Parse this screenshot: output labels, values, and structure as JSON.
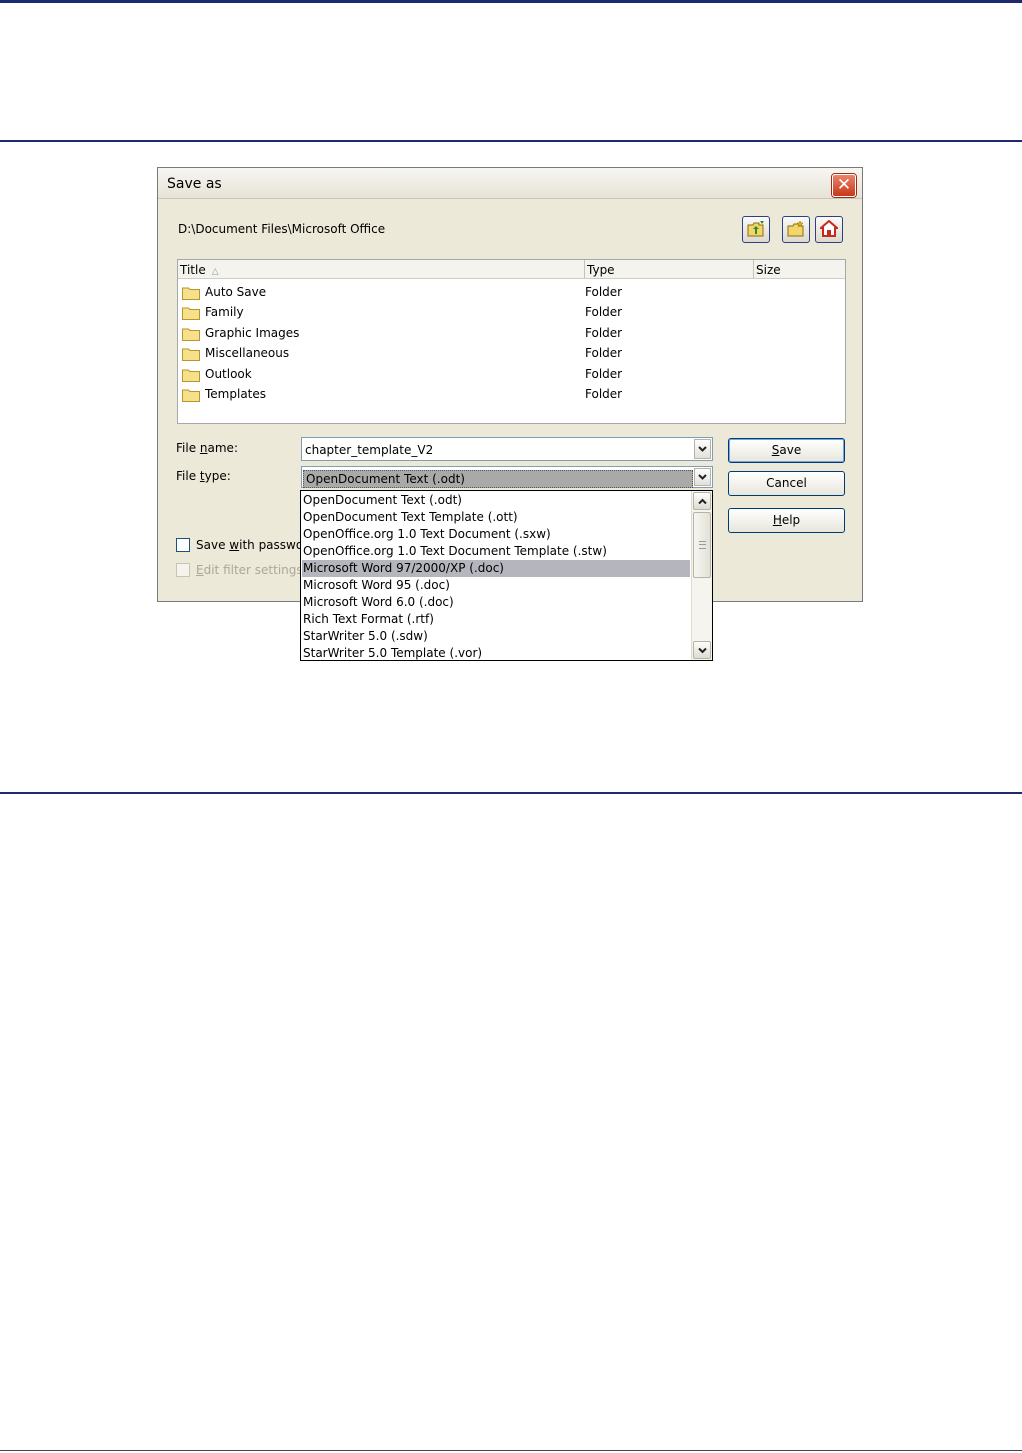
{
  "dialog": {
    "title": "Save as",
    "close_symbol": "✕",
    "path": "D:\\Document Files\\Microsoft Office",
    "toolbar": {
      "up_icon": "folder-up-icon",
      "new_folder_icon": "new-folder-icon",
      "home_icon": "home-icon"
    },
    "columns": {
      "title": "Title",
      "sort_symbol": "△",
      "type": "Type",
      "size": "Size"
    },
    "files": [
      {
        "name": "Auto Save",
        "type": "Folder"
      },
      {
        "name": "Family",
        "type": "Folder"
      },
      {
        "name": "Graphic Images",
        "type": "Folder"
      },
      {
        "name": "Miscellaneous",
        "type": "Folder"
      },
      {
        "name": "Outlook",
        "type": "Folder"
      },
      {
        "name": "Templates",
        "type": "Folder"
      }
    ],
    "file_name_label_pre": "File ",
    "file_name_label_ul": "n",
    "file_name_label_post": "ame:",
    "file_name_value": "chapter_template_V2",
    "file_type_label_pre": "File ",
    "file_type_label_ul": "t",
    "file_type_label_post": "ype:",
    "file_type_value": "OpenDocument Text (.odt)",
    "buttons": {
      "save_ul": "S",
      "save_rest": "ave",
      "cancel": "Cancel",
      "help_ul": "H",
      "help_rest": "elp"
    },
    "save_password_pre": "Save ",
    "save_password_ul": "w",
    "save_password_post": "ith passwo",
    "edit_filter_ul": "E",
    "edit_filter_post": "dit filter settings",
    "file_type_options": [
      "OpenDocument Text (.odt)",
      "OpenDocument Text Template (.ott)",
      "OpenOffice.org 1.0 Text Document (.sxw)",
      "OpenOffice.org 1.0 Text Document Template (.stw)",
      "Microsoft Word 97/2000/XP (.doc)",
      "Microsoft Word 95 (.doc)",
      "Microsoft Word 6.0 (.doc)",
      "Rich Text Format (.rtf)",
      "StarWriter 5.0 (.sdw)",
      "StarWriter 5.0 Template (.vor)"
    ],
    "selected_option_index": 4,
    "colors": {
      "accent": "#1e2a6e",
      "selection": "#b5b5bd",
      "dialog_bg": "#ece9d8"
    }
  }
}
